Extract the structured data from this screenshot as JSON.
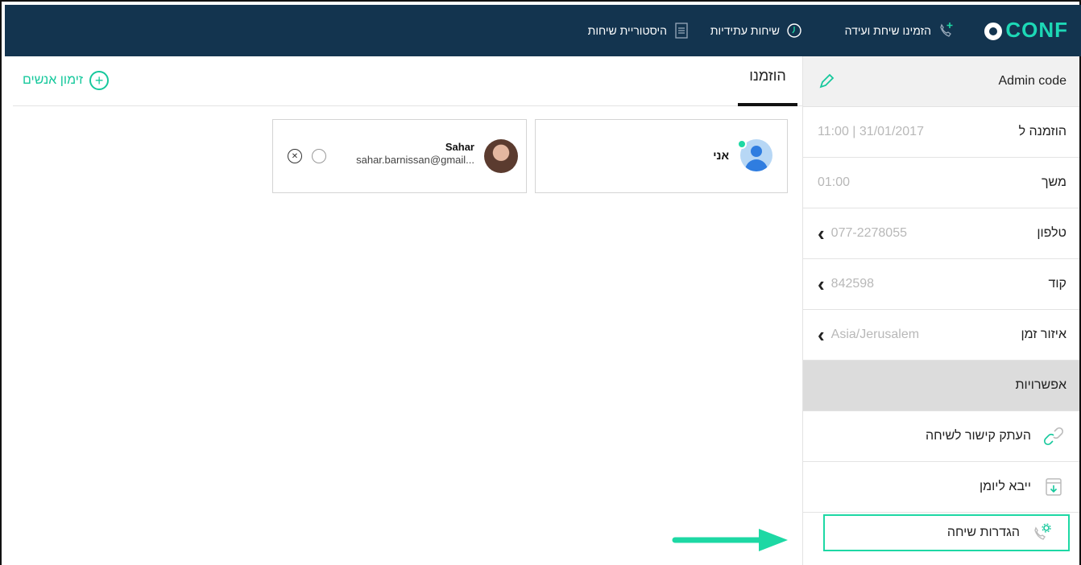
{
  "app": {
    "logo": "CONF"
  },
  "nav": {
    "invite_label": "הזמינו שיחת ועידה",
    "future_label": "שיחות עתידיות",
    "history_label": "היסטוריית שיחות"
  },
  "main": {
    "tab_invited": "הוזמנו",
    "invite_people": "זימון אנשים",
    "participants": [
      {
        "name": "אני"
      },
      {
        "name": "Sahar",
        "email": "sahar.barnissan@gmail..."
      }
    ]
  },
  "sidebar": {
    "admin_code": "Admin code",
    "invited_to_label": "הוזמנה ל",
    "invited_to_value": "11:00 | 31/01/2017",
    "duration_label": "משך",
    "duration_value": "01:00",
    "phone_label": "טלפון",
    "phone_value": "077-2278055",
    "code_label": "קוד",
    "code_value": "842598",
    "timezone_label": "איזור זמן",
    "timezone_value": "Asia/Jerusalem",
    "options_header": "אפשרויות",
    "options": {
      "copy_link": "העתק קישור לשיחה",
      "export_calendar": "ייבא ליומן",
      "call_settings": "הגדרות שיחה"
    }
  },
  "colors": {
    "accent": "#1dd8a4",
    "topbar": "#13344f"
  },
  "icons": [
    "phone-plus-icon",
    "clock-icon",
    "document-icon",
    "pencil-icon",
    "chevron-left-icon",
    "link-icon",
    "calendar-download-icon",
    "phone-settings-icon",
    "plus-circle-icon",
    "close-circle-icon"
  ]
}
